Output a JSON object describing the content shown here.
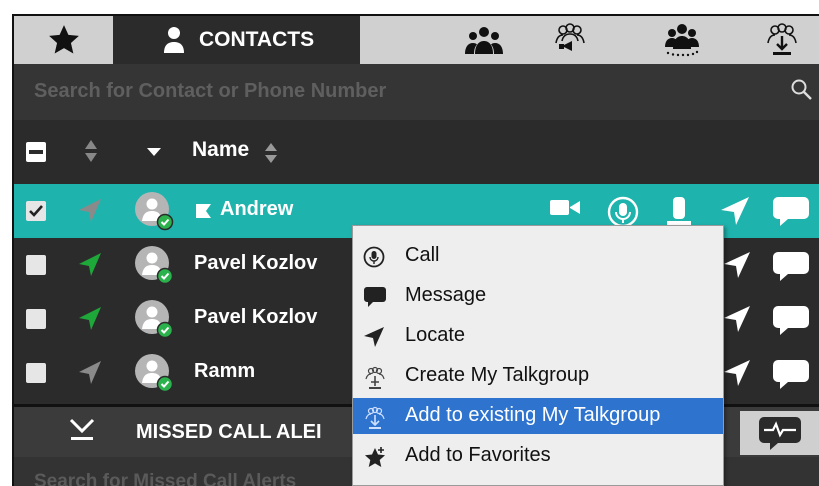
{
  "tabs": {
    "active_label": "CONTACTS"
  },
  "search": {
    "placeholder": "Search for Contact or Phone Number"
  },
  "list_header": {
    "name_label": "Name"
  },
  "contacts": [
    {
      "name": "Andrew",
      "selected": true,
      "checked": true,
      "located": false
    },
    {
      "name": "Pavel Kozlov",
      "selected": false,
      "checked": false,
      "located": true
    },
    {
      "name": "Pavel Kozlov",
      "selected": false,
      "checked": false,
      "located": true
    },
    {
      "name": "Ramm",
      "selected": false,
      "checked": false,
      "located": false
    }
  ],
  "alerts_bar": {
    "label": "MISSED CALL ALEI",
    "search_placeholder": "Search for Missed Call Alerts"
  },
  "context_menu": {
    "items": [
      {
        "label": "Call",
        "icon": "call-icon"
      },
      {
        "label": "Message",
        "icon": "message-icon"
      },
      {
        "label": "Locate",
        "icon": "locate-icon"
      },
      {
        "label": "Create My Talkgroup",
        "icon": "create-talkgroup-icon"
      },
      {
        "label": "Add to existing My Talkgroup",
        "icon": "add-talkgroup-icon",
        "highlighted": true
      },
      {
        "label": "Add to Favorites",
        "icon": "add-favorite-icon"
      }
    ]
  },
  "colors": {
    "selected_row": "#1fb3ad",
    "menu_highlight": "#2e74cf",
    "presence_green": "#2bb24c",
    "location_green": "#1fa83a"
  }
}
